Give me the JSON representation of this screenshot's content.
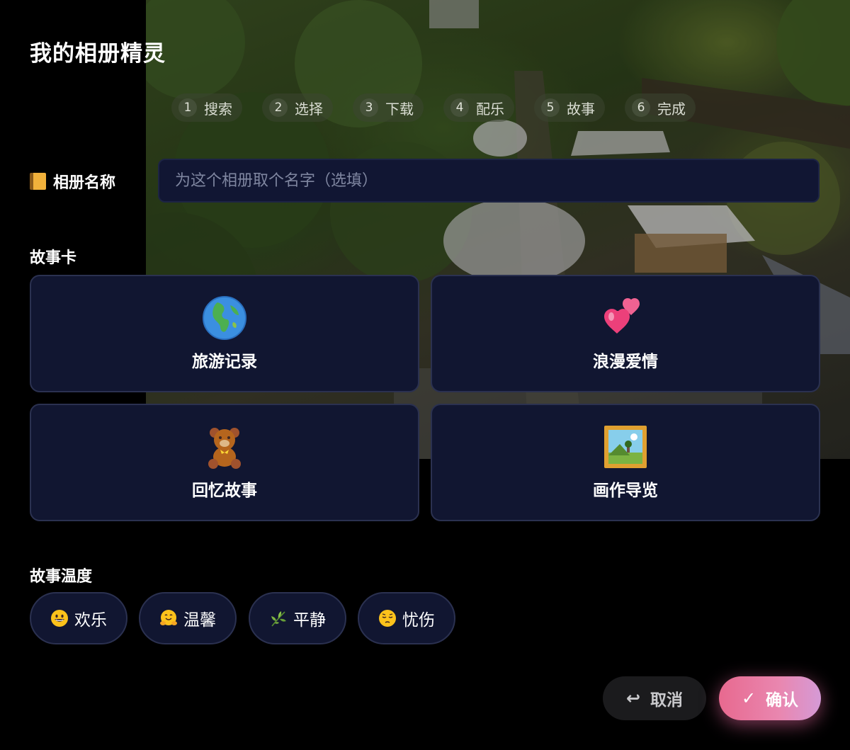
{
  "app": {
    "title": "我的相册精灵"
  },
  "steps": [
    {
      "num": "1",
      "label": "搜索"
    },
    {
      "num": "2",
      "label": "选择"
    },
    {
      "num": "3",
      "label": "下载"
    },
    {
      "num": "4",
      "label": "配乐"
    },
    {
      "num": "5",
      "label": "故事"
    },
    {
      "num": "6",
      "label": "完成"
    }
  ],
  "album": {
    "label": "相册名称",
    "icon": "notebook-icon",
    "value": "",
    "placeholder": "为这个相册取个名字（选填）"
  },
  "story_cards": {
    "label": "故事卡",
    "items": [
      {
        "label": "旅游记录",
        "icon": "globe-icon"
      },
      {
        "label": "浪漫爱情",
        "icon": "two-hearts-icon"
      },
      {
        "label": "回忆故事",
        "icon": "teddy-bear-icon"
      },
      {
        "label": "画作导览",
        "icon": "framed-picture-icon"
      }
    ]
  },
  "mood": {
    "label": "故事温度",
    "items": [
      {
        "label": "欢乐",
        "icon": "grinning-face-icon"
      },
      {
        "label": "温馨",
        "icon": "hugging-face-icon"
      },
      {
        "label": "平静",
        "icon": "herb-icon"
      },
      {
        "label": "忧伤",
        "icon": "pensive-face-icon"
      }
    ]
  },
  "actions": {
    "cancel_label": "取消",
    "cancel_icon": "↩",
    "confirm_label": "确认",
    "confirm_icon": "✓"
  },
  "colors": {
    "card_bg": "#111631",
    "card_border": "#2b3150",
    "confirm_gradient_start": "#e8698f",
    "confirm_gradient_end": "#d59ad6"
  }
}
